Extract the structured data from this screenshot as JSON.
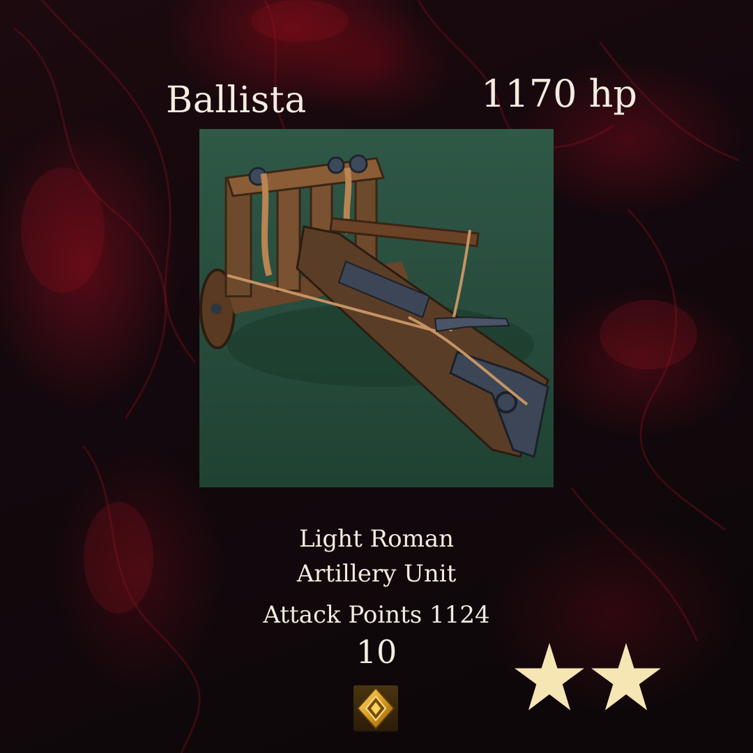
{
  "card": {
    "name": "Ballista",
    "hp": "1170 hp",
    "description_line1": "Light Roman",
    "description_line2": "Artillery Unit",
    "attack": "Attack Points 1124",
    "level": "10",
    "stars": 2,
    "unit_image": "ballista-siege-weapon",
    "rank_icon": "gold-diamond-rank-icon",
    "star_icon": "star-icon"
  },
  "colors": {
    "text": "#f3ece0",
    "star": "#f6e6b4",
    "art_background": "#2f5847",
    "background": "#12080d",
    "smoke": "#8c0c1c"
  }
}
